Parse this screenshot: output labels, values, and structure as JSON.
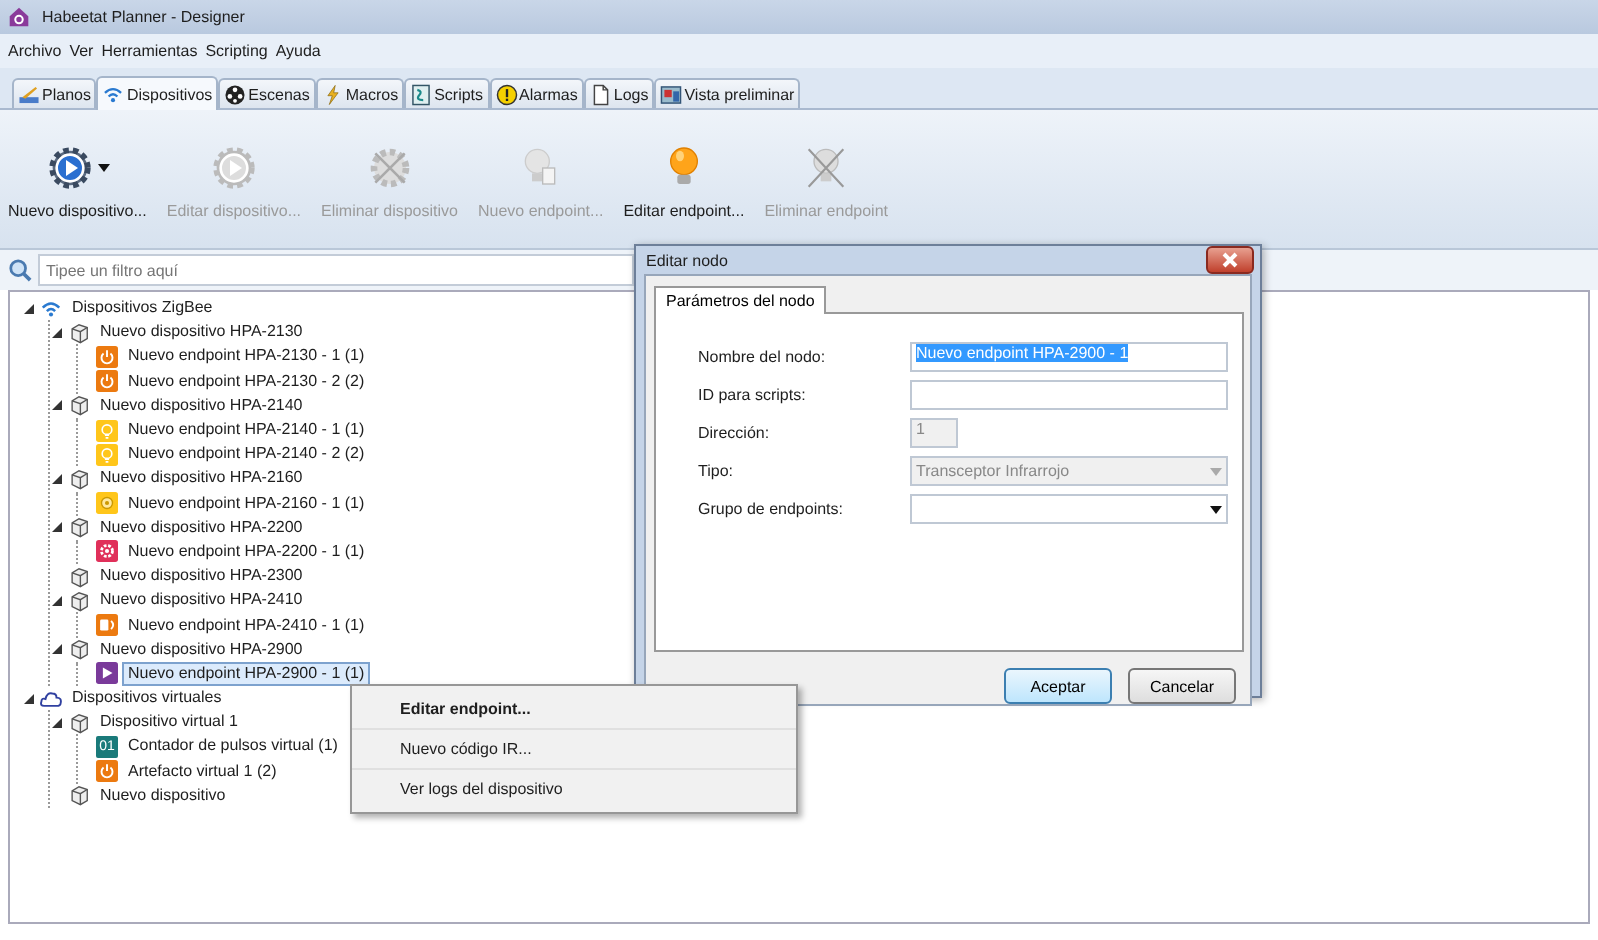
{
  "window": {
    "title": "Habeetat Planner - Designer"
  },
  "menu": [
    "Archivo",
    "Ver",
    "Herramientas",
    "Scripting",
    "Ayuda"
  ],
  "tabs": [
    {
      "label": "Planos",
      "kind": "plans",
      "selected": false
    },
    {
      "label": "Dispositivos",
      "kind": "wifi",
      "selected": true
    },
    {
      "label": "Escenas",
      "kind": "reel",
      "selected": false
    },
    {
      "label": "Macros",
      "kind": "bolt",
      "selected": false
    },
    {
      "label": "Scripts",
      "kind": "script",
      "selected": false
    },
    {
      "label": "Alarmas",
      "kind": "alarm",
      "selected": false
    },
    {
      "label": "Logs",
      "kind": "page",
      "selected": false
    },
    {
      "label": "Vista preliminar",
      "kind": "preview",
      "selected": false
    }
  ],
  "toolbar": [
    {
      "label": "Nuevo dispositivo...",
      "kind": "gear-play",
      "disabled": false,
      "dropdown": true
    },
    {
      "label": "Editar dispositivo...",
      "kind": "gear-play",
      "disabled": true,
      "dropdown": false
    },
    {
      "label": "Eliminar dispositivo",
      "kind": "gear-x",
      "disabled": true,
      "dropdown": false
    },
    {
      "label": "Nuevo endpoint...",
      "kind": "bulb-page",
      "disabled": true,
      "dropdown": false
    },
    {
      "label": "Editar endpoint...",
      "kind": "bulb",
      "disabled": false,
      "dropdown": false
    },
    {
      "label": "Eliminar endpoint",
      "kind": "bulb-x",
      "disabled": true,
      "dropdown": false
    }
  ],
  "filter": {
    "placeholder": "Tipee un filtro aquí"
  },
  "tree": [
    {
      "label": "Dispositivos ZigBee",
      "kind": "wifi",
      "expanded": true,
      "selected": false,
      "children": [
        {
          "label": "Nuevo dispositivo HPA-2130",
          "kind": "device",
          "expanded": true,
          "selected": false,
          "children": [
            {
              "label": "Nuevo endpoint HPA-2130 - 1 (1)",
              "kind": "power",
              "selected": false
            },
            {
              "label": "Nuevo endpoint HPA-2130 - 2 (2)",
              "kind": "power",
              "selected": false
            }
          ]
        },
        {
          "label": "Nuevo dispositivo HPA-2140",
          "kind": "device",
          "expanded": true,
          "selected": false,
          "children": [
            {
              "label": "Nuevo endpoint HPA-2140 - 1 (1)",
              "kind": "bulb",
              "selected": false
            },
            {
              "label": "Nuevo endpoint HPA-2140 - 2 (2)",
              "kind": "bulb",
              "selected": false
            }
          ]
        },
        {
          "label": "Nuevo dispositivo HPA-2160",
          "kind": "device",
          "expanded": true,
          "selected": false,
          "children": [
            {
              "label": "Nuevo endpoint HPA-2160 - 1 (1)",
              "kind": "lamp",
              "selected": false
            }
          ]
        },
        {
          "label": "Nuevo dispositivo HPA-2200",
          "kind": "device",
          "expanded": true,
          "selected": false,
          "children": [
            {
              "label": "Nuevo endpoint HPA-2200 - 1 (1)",
              "kind": "gear",
              "selected": false
            }
          ]
        },
        {
          "label": "Nuevo dispositivo HPA-2300",
          "kind": "device",
          "selected": false
        },
        {
          "label": "Nuevo dispositivo HPA-2410",
          "kind": "device",
          "expanded": true,
          "selected": false,
          "children": [
            {
              "label": "Nuevo endpoint HPA-2410 - 1 (1)",
              "kind": "ir",
              "selected": false
            }
          ]
        },
        {
          "label": "Nuevo dispositivo HPA-2900",
          "kind": "device",
          "expanded": true,
          "selected": false,
          "children": [
            {
              "label": "Nuevo endpoint HPA-2900 - 1 (1)",
              "kind": "play",
              "selected": true
            }
          ]
        }
      ]
    },
    {
      "label": "Dispositivos virtuales",
      "kind": "cloud",
      "expanded": true,
      "selected": false,
      "children": [
        {
          "label": "Dispositivo virtual 1",
          "kind": "device",
          "expanded": true,
          "selected": false,
          "children": [
            {
              "label": "Contador de pulsos virtual (1)",
              "kind": "counter",
              "badge": "01",
              "selected": false
            },
            {
              "label": "Artefacto virtual 1 (2)",
              "kind": "power",
              "selected": false
            }
          ]
        },
        {
          "label": "Nuevo dispositivo",
          "kind": "device",
          "selected": false
        }
      ]
    }
  ],
  "context_menu": [
    {
      "label": "Editar endpoint...",
      "default": true
    },
    {
      "label": "Nuevo código IR...",
      "default": false
    },
    {
      "label": "Ver logs del dispositivo",
      "default": false
    }
  ],
  "dialog": {
    "title": "Editar nodo",
    "tabs": [
      {
        "label": "Parámetros del nodo",
        "selected": true
      }
    ],
    "fields": [
      {
        "label": "Nombre del nodo:",
        "kind": "text",
        "value": "Nuevo endpoint HPA-2900 - 1",
        "highlighted": true
      },
      {
        "label": "ID para scripts:",
        "kind": "text"
      },
      {
        "label": "Dirección:",
        "kind": "short",
        "value": "1",
        "disabled": true
      },
      {
        "label": "Tipo:",
        "kind": "combo",
        "value": "Transceptor Infrarrojo",
        "disabled": true
      },
      {
        "label": "Grupo de endpoints:",
        "kind": "combo",
        "disabled": false
      }
    ],
    "buttons": [
      {
        "label": "Aceptar",
        "default": true
      },
      {
        "label": "Cancelar",
        "default": false
      }
    ]
  }
}
